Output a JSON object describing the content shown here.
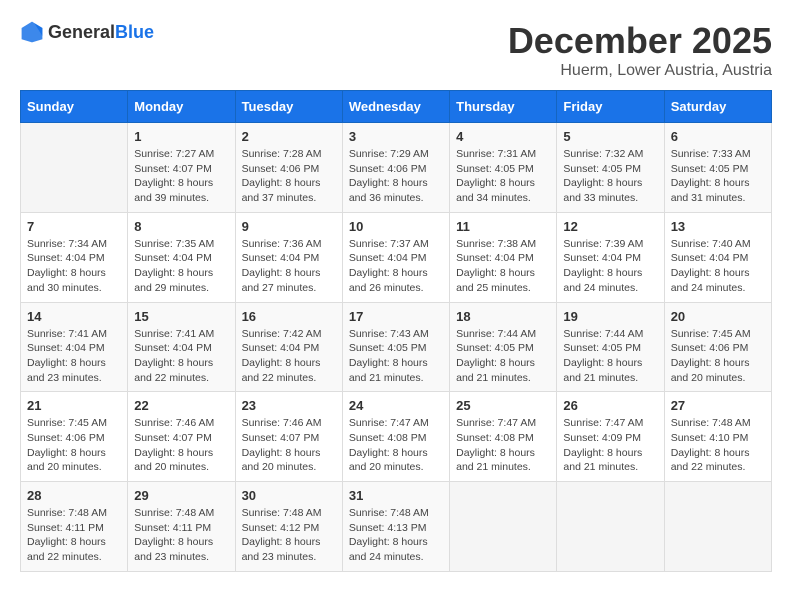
{
  "logo": {
    "general": "General",
    "blue": "Blue"
  },
  "header": {
    "month": "December 2025",
    "location": "Huerm, Lower Austria, Austria"
  },
  "weekdays": [
    "Sunday",
    "Monday",
    "Tuesday",
    "Wednesday",
    "Thursday",
    "Friday",
    "Saturday"
  ],
  "weeks": [
    [
      {
        "day": "",
        "info": ""
      },
      {
        "day": "1",
        "info": "Sunrise: 7:27 AM\nSunset: 4:07 PM\nDaylight: 8 hours\nand 39 minutes."
      },
      {
        "day": "2",
        "info": "Sunrise: 7:28 AM\nSunset: 4:06 PM\nDaylight: 8 hours\nand 37 minutes."
      },
      {
        "day": "3",
        "info": "Sunrise: 7:29 AM\nSunset: 4:06 PM\nDaylight: 8 hours\nand 36 minutes."
      },
      {
        "day": "4",
        "info": "Sunrise: 7:31 AM\nSunset: 4:05 PM\nDaylight: 8 hours\nand 34 minutes."
      },
      {
        "day": "5",
        "info": "Sunrise: 7:32 AM\nSunset: 4:05 PM\nDaylight: 8 hours\nand 33 minutes."
      },
      {
        "day": "6",
        "info": "Sunrise: 7:33 AM\nSunset: 4:05 PM\nDaylight: 8 hours\nand 31 minutes."
      }
    ],
    [
      {
        "day": "7",
        "info": "Sunrise: 7:34 AM\nSunset: 4:04 PM\nDaylight: 8 hours\nand 30 minutes."
      },
      {
        "day": "8",
        "info": "Sunrise: 7:35 AM\nSunset: 4:04 PM\nDaylight: 8 hours\nand 29 minutes."
      },
      {
        "day": "9",
        "info": "Sunrise: 7:36 AM\nSunset: 4:04 PM\nDaylight: 8 hours\nand 27 minutes."
      },
      {
        "day": "10",
        "info": "Sunrise: 7:37 AM\nSunset: 4:04 PM\nDaylight: 8 hours\nand 26 minutes."
      },
      {
        "day": "11",
        "info": "Sunrise: 7:38 AM\nSunset: 4:04 PM\nDaylight: 8 hours\nand 25 minutes."
      },
      {
        "day": "12",
        "info": "Sunrise: 7:39 AM\nSunset: 4:04 PM\nDaylight: 8 hours\nand 24 minutes."
      },
      {
        "day": "13",
        "info": "Sunrise: 7:40 AM\nSunset: 4:04 PM\nDaylight: 8 hours\nand 24 minutes."
      }
    ],
    [
      {
        "day": "14",
        "info": "Sunrise: 7:41 AM\nSunset: 4:04 PM\nDaylight: 8 hours\nand 23 minutes."
      },
      {
        "day": "15",
        "info": "Sunrise: 7:41 AM\nSunset: 4:04 PM\nDaylight: 8 hours\nand 22 minutes."
      },
      {
        "day": "16",
        "info": "Sunrise: 7:42 AM\nSunset: 4:04 PM\nDaylight: 8 hours\nand 22 minutes."
      },
      {
        "day": "17",
        "info": "Sunrise: 7:43 AM\nSunset: 4:05 PM\nDaylight: 8 hours\nand 21 minutes."
      },
      {
        "day": "18",
        "info": "Sunrise: 7:44 AM\nSunset: 4:05 PM\nDaylight: 8 hours\nand 21 minutes."
      },
      {
        "day": "19",
        "info": "Sunrise: 7:44 AM\nSunset: 4:05 PM\nDaylight: 8 hours\nand 21 minutes."
      },
      {
        "day": "20",
        "info": "Sunrise: 7:45 AM\nSunset: 4:06 PM\nDaylight: 8 hours\nand 20 minutes."
      }
    ],
    [
      {
        "day": "21",
        "info": "Sunrise: 7:45 AM\nSunset: 4:06 PM\nDaylight: 8 hours\nand 20 minutes."
      },
      {
        "day": "22",
        "info": "Sunrise: 7:46 AM\nSunset: 4:07 PM\nDaylight: 8 hours\nand 20 minutes."
      },
      {
        "day": "23",
        "info": "Sunrise: 7:46 AM\nSunset: 4:07 PM\nDaylight: 8 hours\nand 20 minutes."
      },
      {
        "day": "24",
        "info": "Sunrise: 7:47 AM\nSunset: 4:08 PM\nDaylight: 8 hours\nand 20 minutes."
      },
      {
        "day": "25",
        "info": "Sunrise: 7:47 AM\nSunset: 4:08 PM\nDaylight: 8 hours\nand 21 minutes."
      },
      {
        "day": "26",
        "info": "Sunrise: 7:47 AM\nSunset: 4:09 PM\nDaylight: 8 hours\nand 21 minutes."
      },
      {
        "day": "27",
        "info": "Sunrise: 7:48 AM\nSunset: 4:10 PM\nDaylight: 8 hours\nand 22 minutes."
      }
    ],
    [
      {
        "day": "28",
        "info": "Sunrise: 7:48 AM\nSunset: 4:11 PM\nDaylight: 8 hours\nand 22 minutes."
      },
      {
        "day": "29",
        "info": "Sunrise: 7:48 AM\nSunset: 4:11 PM\nDaylight: 8 hours\nand 23 minutes."
      },
      {
        "day": "30",
        "info": "Sunrise: 7:48 AM\nSunset: 4:12 PM\nDaylight: 8 hours\nand 23 minutes."
      },
      {
        "day": "31",
        "info": "Sunrise: 7:48 AM\nSunset: 4:13 PM\nDaylight: 8 hours\nand 24 minutes."
      },
      {
        "day": "",
        "info": ""
      },
      {
        "day": "",
        "info": ""
      },
      {
        "day": "",
        "info": ""
      }
    ]
  ]
}
